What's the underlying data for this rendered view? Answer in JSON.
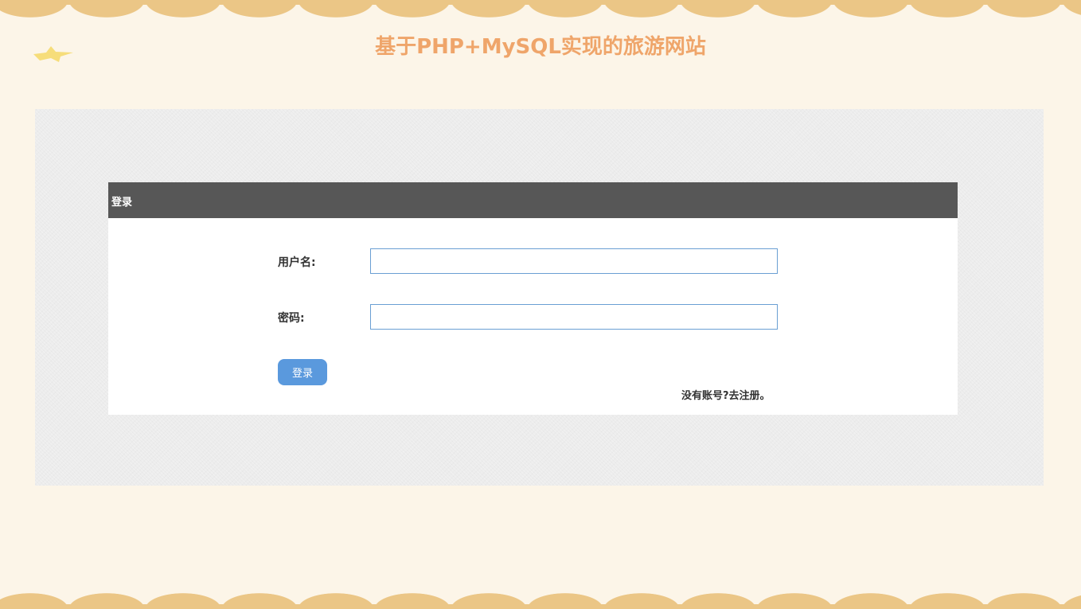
{
  "site": {
    "title": "基于PHP+MySQL实现的旅游网站"
  },
  "login": {
    "header_title": "登录",
    "username_label": "用户名:",
    "password_label": "密码:",
    "username_value": "",
    "password_value": "",
    "submit_label": "登录",
    "register_link": "没有账号?去注册。"
  },
  "colors": {
    "accent_title": "#efa56a",
    "scallop_border": "#ebc686",
    "header_bar": "#575757",
    "button": "#5a99dd",
    "input_border": "#6a9fd3"
  },
  "icons": {
    "decorative_star": "star-icon"
  }
}
